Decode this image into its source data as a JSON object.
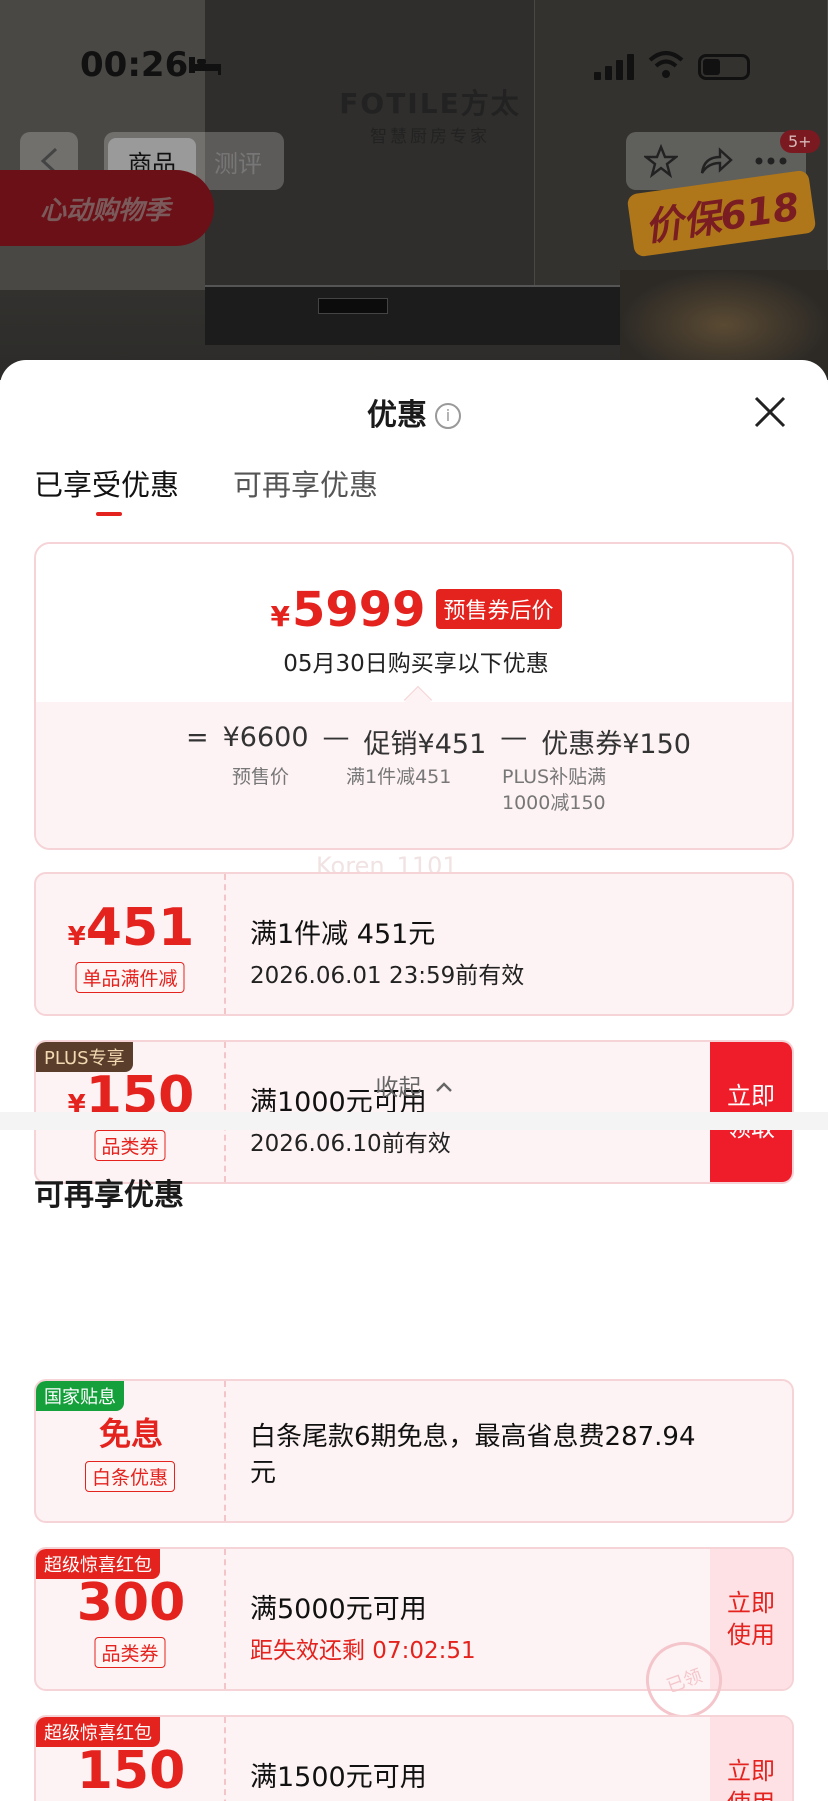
{
  "status_bar": {
    "time": "00:26"
  },
  "brand": {
    "name": "FOTILE方太",
    "slogan": "智慧厨房专家"
  },
  "top_nav": {
    "tabs": [
      {
        "label": "商品"
      },
      {
        "label": "测评"
      }
    ],
    "badge": "5+",
    "promo_left": "心动购物季",
    "promo_right": "价保618"
  },
  "sheet": {
    "title": "优惠",
    "tabs": [
      {
        "label": "已享受优惠"
      },
      {
        "label": "可再享优惠"
      }
    ],
    "summary": {
      "currency": "¥",
      "final_price": "5999",
      "price_tag": "预售券后价",
      "date_note": "05月30日购买享以下优惠",
      "formula": {
        "eq": "=",
        "presale": "¥6600",
        "minus": "—",
        "promo": "促销¥451",
        "coupon": "优惠券¥150",
        "presale_label": "预售价",
        "promo_label": "满1件减451",
        "coupon_label_1": "PLUS补贴满",
        "coupon_label_2": "1000减150"
      }
    },
    "watermark": "Koren_1101",
    "enjoyed": [
      {
        "currency": "¥",
        "amount": "451",
        "chip": "单品满件减",
        "line1": "满1件减 451元",
        "line2": "2026.06.01 23:59前有效"
      },
      {
        "ribbon": "PLUS专享",
        "currency": "¥",
        "amount": "150",
        "chip": "品类券",
        "line1": "满1000元可用",
        "line2": "2026.06.10前有效",
        "cta": "立即领取"
      }
    ],
    "collapse_label": "收起",
    "section2_title": "可再享优惠",
    "more": [
      {
        "ribbon": "国家贴息",
        "amount": "免息",
        "chip": "白条优惠",
        "line1": "白条尾款6期免息，最高省息费287.94",
        "line1b": "元"
      },
      {
        "ribbon": "超级惊喜红包",
        "amount": "300",
        "chip": "品类券",
        "line1": "满5000元可用",
        "line2": "距失效还剩 07:02:51",
        "cta": "立即使用",
        "stamp": "已领"
      },
      {
        "ribbon": "超级惊喜红包",
        "amount": "150",
        "line1": "满1500元可用",
        "cta": "立即使用"
      }
    ]
  },
  "colors": {
    "accent": "#e4231e",
    "card_bg": "#fdf3f4",
    "plus_ribbon": "#5a3d2b",
    "gov_ribbon": "#15a03c"
  }
}
